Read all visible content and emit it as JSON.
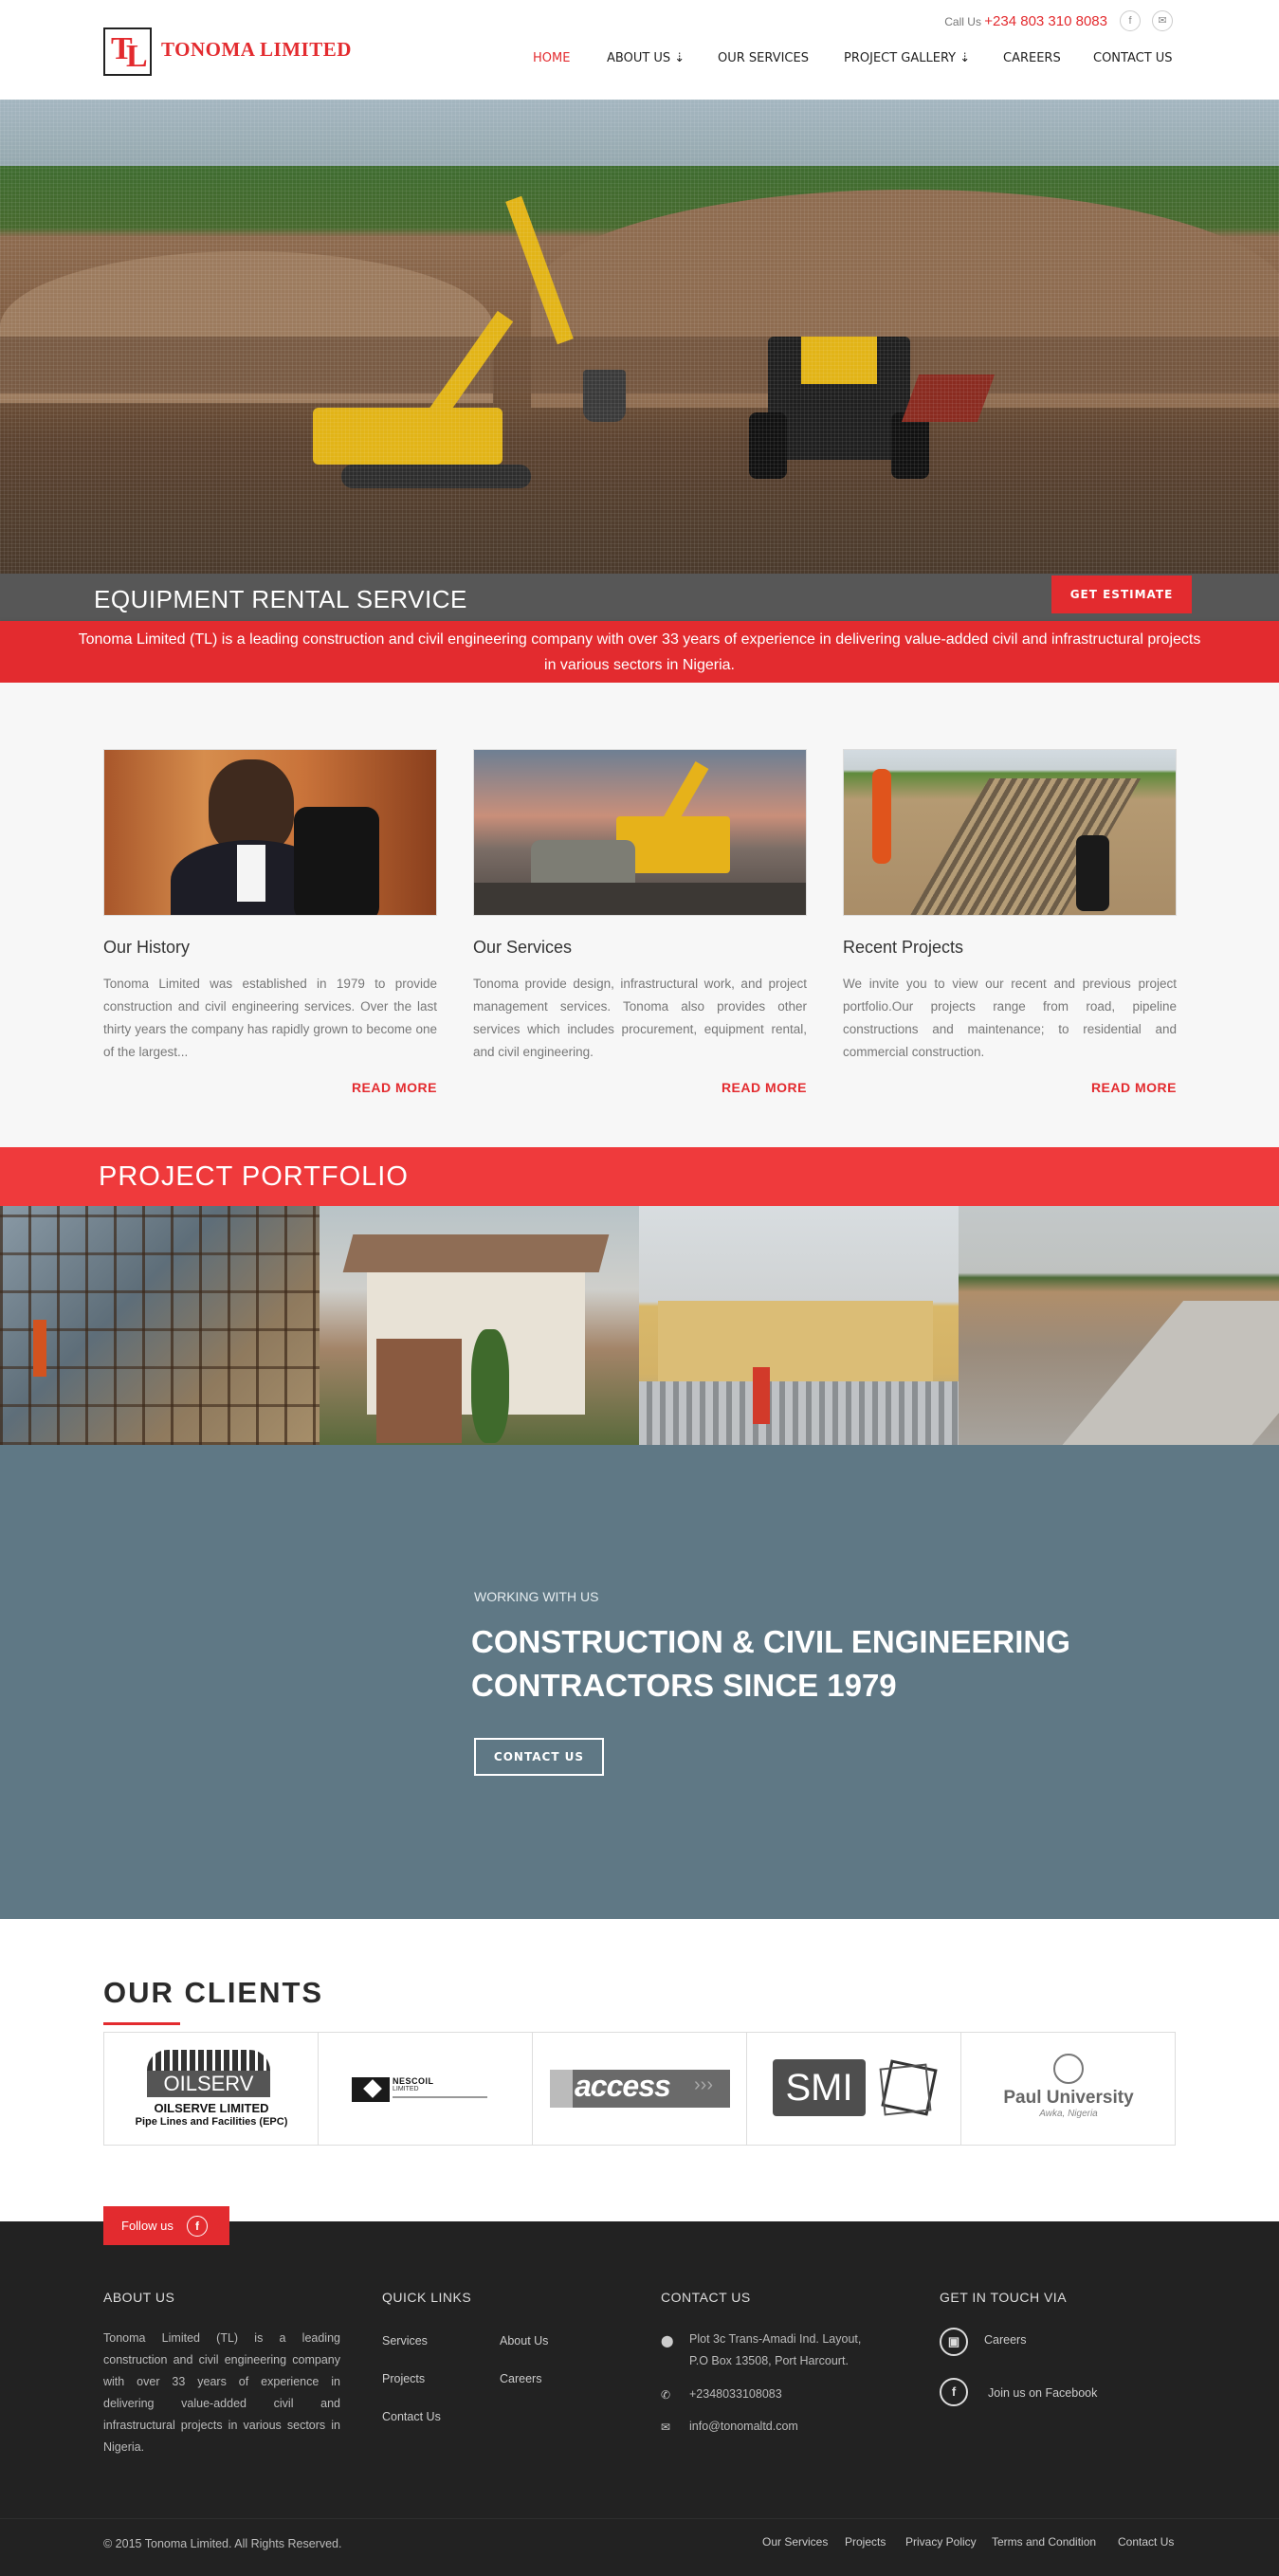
{
  "header": {
    "logo_letters_t": "T",
    "logo_letters_l": "L",
    "brand": "TONOMA LIMITED",
    "call_label": "Call Us",
    "phone": "+234 803 310 8083",
    "social": {
      "facebook": "f",
      "email": "✉"
    },
    "nav": [
      {
        "label": "HOME"
      },
      {
        "label": "ABOUT US ⇣"
      },
      {
        "label": "OUR SERVICES"
      },
      {
        "label": "PROJECT GALLERY ⇣"
      },
      {
        "label": "CAREERS"
      },
      {
        "label": "CONTACT US"
      }
    ]
  },
  "hero": {
    "caption": "EQUIPMENT RENTAL SERVICE",
    "button": "GET ESTIMATE",
    "intro": "Tonoma Limited (TL) is a leading construction and civil engineering company with over 33 years of experience in delivering value-added civil and infrastructural projects in various sectors in Nigeria."
  },
  "features": [
    {
      "title": "Our History",
      "text": "Tonoma Limited was established in 1979 to provide construction and civil engineering services. Over the last thirty years the company has rapidly grown to become one of the largest...",
      "link": "READ MORE"
    },
    {
      "title": "Our Services",
      "text": "Tonoma provide design, infrastructural work, and project management services. Tonoma also provides other services which includes procurement, equipment rental, and civil engineering.",
      "link": "READ MORE"
    },
    {
      "title": "Recent Projects",
      "text": "We invite you to view our recent and previous project portfolio.Our projects range from road, pipeline constructions and maintenance; to residential and commercial construction.",
      "link": "READ MORE"
    }
  ],
  "portfolio": {
    "title": "PROJECT PORTFOLIO"
  },
  "working": {
    "kicker": "WORKING WITH US",
    "title_line1": "CONSTRUCTION & CIVIL ENGINEERING",
    "title_line2": "CONTRACTORS SINCE 1979",
    "button": "CONTACT US"
  },
  "clients": {
    "title": "OUR CLIENTS",
    "items": [
      {
        "logo_main": "OILSERV",
        "line1": "OILSERVE LIMITED",
        "line2": "Pipe Lines and Facilities (EPC)"
      },
      {
        "logo_main": "NESCOIL",
        "line1": "LIMITED"
      },
      {
        "logo_main": "access"
      },
      {
        "logo_main": "SMI"
      },
      {
        "logo_main": "Paul University",
        "line1": "Awka, Nigeria"
      }
    ]
  },
  "footer": {
    "follow": "Follow us",
    "about": {
      "title": "ABOUT US",
      "text": "Tonoma Limited (TL) is a leading construction and civil engineering company with over 33 years of experience in delivering value-added civil and infrastructural projects in various sectors in Nigeria."
    },
    "quick": {
      "title": "QUICK LINKS",
      "links": [
        "Services",
        "About Us",
        "Projects",
        "Careers",
        "Contact Us"
      ]
    },
    "contact": {
      "title": "CONTACT US",
      "address1": "Plot 3c Trans-Amadi Ind. Layout,",
      "address2": "P.O Box 13508, Port Harcourt.",
      "phone": "+2348033108083",
      "email": "info@tonomaltd.com"
    },
    "touch": {
      "title": "GET IN TOUCH VIA",
      "careers": "Careers",
      "facebook": "Join us on Facebook"
    },
    "copyright": "© 2015 Tonoma Limited. All Rights Reserved.",
    "bottom_links": [
      "Our Services",
      "Projects",
      "Privacy Policy",
      "Terms and Condition",
      "Contact Us"
    ]
  },
  "colors": {
    "accent": "#e32b2f",
    "footer_bg": "#222222",
    "working_bg": "#5f7885"
  }
}
